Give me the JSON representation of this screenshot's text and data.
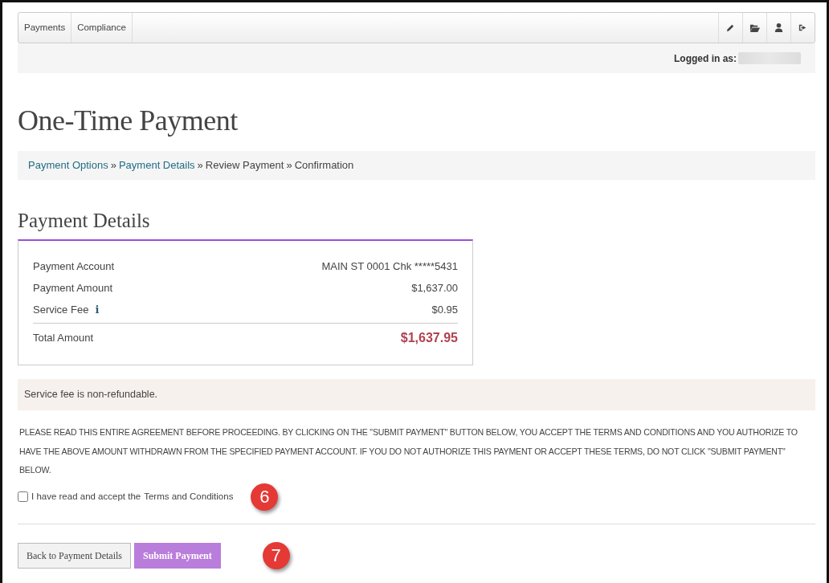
{
  "navbar": {
    "menu": [
      {
        "label": "Payments"
      },
      {
        "label": "Compliance"
      }
    ],
    "icons": [
      {
        "kind": "pencil"
      },
      {
        "kind": "folder"
      },
      {
        "kind": "user"
      },
      {
        "kind": "logout"
      }
    ]
  },
  "login_bar": {
    "label": "Logged in as:",
    "user_redacted": true
  },
  "title": "One-Time Payment",
  "breadcrumb": [
    {
      "label": "Payment Options",
      "link": true
    },
    {
      "label": "Payment Details",
      "link": true
    },
    {
      "label": "Review Payment",
      "link": false
    },
    {
      "label": "Confirmation",
      "link": false
    }
  ],
  "breadcrumb_separator": "»",
  "section_title": "Payment Details",
  "details": [
    {
      "label": "Payment Account",
      "value": "MAIN ST 0001 Chk *****5431",
      "info": false,
      "kind": "row"
    },
    {
      "label": "Payment Amount",
      "value": "$1,637.00",
      "info": false,
      "kind": "row"
    },
    {
      "label": "Service Fee",
      "value": "$0.95",
      "info": true,
      "kind": "row"
    },
    {
      "label": "Total Amount",
      "value": "$1,637.95",
      "info": false,
      "kind": "total"
    }
  ],
  "info_icon": "i",
  "notice": "Service fee is non-refundable.",
  "agreement": "PLEASE READ THIS ENTIRE AGREEMENT BEFORE PROCEEDING. BY CLICKING ON THE \"SUBMIT PAYMENT\" BUTTON BELOW, YOU ACCEPT THE TERMS AND CONDITIONS AND YOU AUTHORIZE TO HAVE THE ABOVE AMOUNT WITHDRAWN FROM THE SPECIFIED PAYMENT ACCOUNT. IF YOU DO NOT AUTHORIZE THIS PAYMENT OR ACCEPT THESE TERMS, DO NOT CLICK \"SUBMIT PAYMENT\" BELOW.",
  "accept": {
    "text": "I have read and accept the",
    "link": "Terms and Conditions",
    "checked": false,
    "callout": "6"
  },
  "buttons": [
    {
      "label": "Back to Payment Details",
      "kind": "secondary"
    },
    {
      "label": "Submit Payment",
      "kind": "primary"
    }
  ],
  "buttons_callout": "7"
}
